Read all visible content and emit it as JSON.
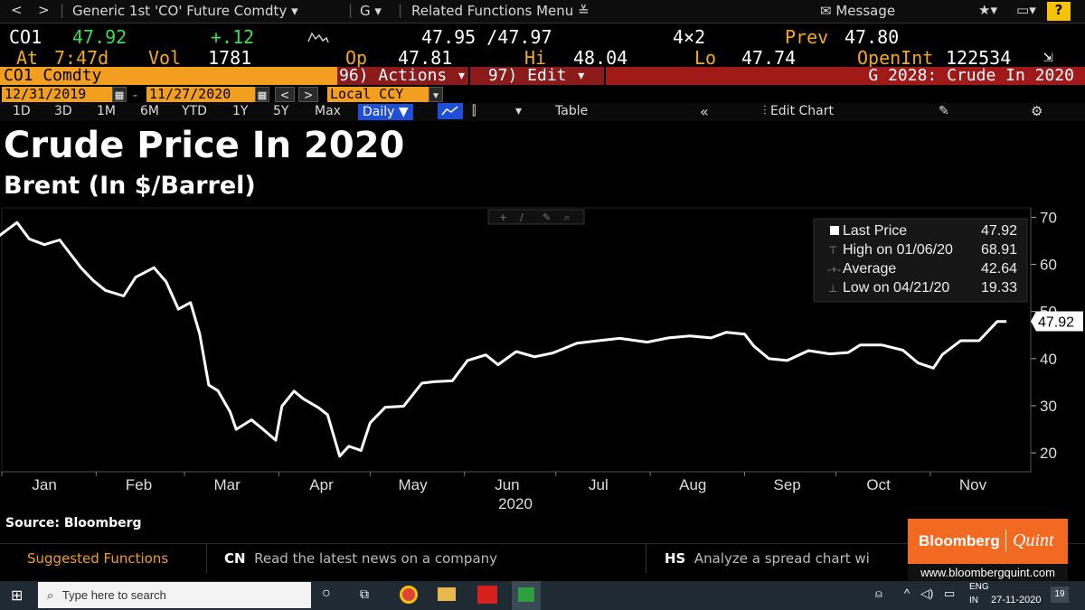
{
  "nav": {
    "back": "<",
    "forward": ">",
    "security": "Generic 1st 'CO' Future Comdty",
    "g_menu": "G",
    "related": "Related Functions Menu",
    "message": "Message",
    "star": "★",
    "help": "?"
  },
  "quote": {
    "ticker": "CO1",
    "last": "47.92",
    "change": "+.12",
    "bid_ask": "47.95 /47.97",
    "size": "4×2",
    "prev_label": "Prev",
    "prev": "47.80",
    "at_label": "At",
    "time": "7:47d",
    "vol_label": "Vol",
    "vol": "1781",
    "op_label": "Op",
    "op": "47.81",
    "hi_label": "Hi",
    "hi": "48.04",
    "lo_label": "Lo",
    "lo": "47.74",
    "oi_label": "OpenInt",
    "oi": "122534"
  },
  "fnbar": {
    "security": "CO1 Comdty",
    "actions": "96) Actions ▾",
    "edit": "97) Edit ▾",
    "graph_title": "G 2028: Crude In 2020"
  },
  "datebar": {
    "start": "12/31/2019",
    "end": "11/27/2020",
    "currency": "Local CCY"
  },
  "periods": [
    "1D",
    "3D",
    "1M",
    "6M",
    "YTD",
    "1Y",
    "5Y",
    "Max"
  ],
  "period_selected": "Daily ▼",
  "toolbar": {
    "table": "Table",
    "edit_chart": "Edit Chart"
  },
  "heading": {
    "title": "Crude Price In 2020",
    "subtitle": "Brent (In $/Barrel)"
  },
  "legend": {
    "last_label": "Last Price",
    "last_value": "47.92",
    "high_label": "High on 01/06/20",
    "high_value": "68.91",
    "avg_label": "Average",
    "avg_value": "42.64",
    "low_label": "Low on 04/21/20",
    "low_value": "19.33"
  },
  "chart_data": {
    "type": "line",
    "title": "Crude Price In 2020",
    "subtitle": "Brent (In $/Barrel)",
    "xlabel": "2020",
    "x_ticks": [
      "Jan",
      "Feb",
      "Mar",
      "Apr",
      "May",
      "Jun",
      "Jul",
      "Aug",
      "Sep",
      "Oct",
      "Nov"
    ],
    "y_ticks": [
      20,
      30,
      40,
      50,
      60,
      70
    ],
    "ylim": [
      16,
      72
    ],
    "last_price_tag": "47.92",
    "series": [
      {
        "name": "Last Price",
        "x": [
          "2019-12-31",
          "2020-01-06",
          "2020-01-10",
          "2020-01-15",
          "2020-01-20",
          "2020-01-27",
          "2020-01-31",
          "2020-02-04",
          "2020-02-10",
          "2020-02-14",
          "2020-02-20",
          "2020-02-24",
          "2020-02-28",
          "2020-03-03",
          "2020-03-06",
          "2020-03-09",
          "2020-03-12",
          "2020-03-16",
          "2020-03-18",
          "2020-03-23",
          "2020-03-27",
          "2020-03-31",
          "2020-04-02",
          "2020-04-06",
          "2020-04-09",
          "2020-04-14",
          "2020-04-17",
          "2020-04-21",
          "2020-04-24",
          "2020-04-28",
          "2020-05-01",
          "2020-05-06",
          "2020-05-12",
          "2020-05-18",
          "2020-05-22",
          "2020-05-28",
          "2020-06-02",
          "2020-06-08",
          "2020-06-12",
          "2020-06-18",
          "2020-06-24",
          "2020-06-30",
          "2020-07-08",
          "2020-07-15",
          "2020-07-22",
          "2020-07-31",
          "2020-08-07",
          "2020-08-14",
          "2020-08-21",
          "2020-08-26",
          "2020-09-01",
          "2020-09-04",
          "2020-09-09",
          "2020-09-15",
          "2020-09-22",
          "2020-09-29",
          "2020-10-05",
          "2020-10-09",
          "2020-10-16",
          "2020-10-23",
          "2020-10-28",
          "2020-11-02",
          "2020-11-05",
          "2020-11-11",
          "2020-11-17",
          "2020-11-23",
          "2020-11-26"
        ],
        "values": [
          66.0,
          68.9,
          65.4,
          64.2,
          65.2,
          59.3,
          56.6,
          54.5,
          53.3,
          57.3,
          59.3,
          56.3,
          50.5,
          51.9,
          45.3,
          34.4,
          33.2,
          28.7,
          25.0,
          27.0,
          24.9,
          22.7,
          29.9,
          33.1,
          31.5,
          29.6,
          28.1,
          19.3,
          21.4,
          20.5,
          26.4,
          29.7,
          29.9,
          34.8,
          35.1,
          35.3,
          39.6,
          40.8,
          38.7,
          41.5,
          40.4,
          41.2,
          43.3,
          43.8,
          44.3,
          43.5,
          44.4,
          44.8,
          44.4,
          45.6,
          45.2,
          42.7,
          40.0,
          39.6,
          41.7,
          41.0,
          41.3,
          42.9,
          42.9,
          41.8,
          39.1,
          38.0,
          40.9,
          43.8,
          43.8,
          47.9,
          47.9
        ]
      }
    ],
    "summary": {
      "last": 47.92,
      "high": 68.91,
      "high_date": "01/06/20",
      "average": 42.64,
      "low": 19.33,
      "low_date": "04/21/20"
    }
  },
  "source": "Source: Bloomberg",
  "suggest": {
    "label": "Suggested Functions",
    "items": [
      {
        "code": "CN",
        "text": "Read the latest news on a company"
      },
      {
        "code": "HS",
        "text": "Analyze a spread chart wi"
      }
    ]
  },
  "logo": {
    "brand": "Bloomberg",
    "brand2": "Quint",
    "url": "www.bloombergquint.com"
  },
  "taskbar": {
    "search_placeholder": "Type here to search",
    "lang": "ENG",
    "region": "IN",
    "date": "27-11-2020",
    "notif_count": "19"
  }
}
